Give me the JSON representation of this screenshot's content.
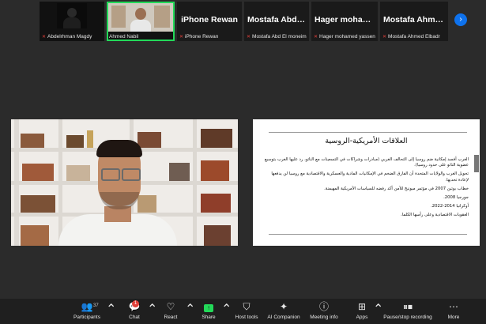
{
  "participants": [
    {
      "big": "",
      "caption": "Abdelrhman Magdy",
      "video": true
    },
    {
      "big": "",
      "caption": "Ahmed Nabil",
      "video": true,
      "active": true
    },
    {
      "big": "iPhone Rewan",
      "caption": "iPhone Rewan"
    },
    {
      "big": "Mostafa Abd El...",
      "caption": "Mostafa Abd El moneim"
    },
    {
      "big": "Hager mohame...",
      "caption": "Hager mohamed yassen"
    },
    {
      "big": "Mostafa Ahmed...",
      "caption": "Mostafa Ahmed Elbadr"
    }
  ],
  "slide": {
    "title": "العلاقات الأمريكية-الروسية",
    "bullets": [
      "الغرب أفسد إمكانية ضم روسيا إلى التحالف الغربي (مبادرات وشراكات في التسعينات مع الناتو، رد عليها الغرب بتوسيع عضوية الناتو على حدود روسيا).",
      "تحويل الغرب والولايات المتحدة أن الفارق الضخم في الإمكانيات المادية والعسكرية والاقتصادية مع روسيا لن يدفعها لإعادة تحديها.",
      "خطاب بوتين 2007 في مؤتمر ميونيخ للأمن أكد رفضه للسياسات الأمريكية المهيمنة.",
      "جورجيا 2008.",
      "أوكرانيا 2014-2022.",
      "العقوبات الاقتصادية وعلى رأسها الكلما."
    ]
  },
  "toolbar": {
    "participants_label": "Participants",
    "participants_count": "37",
    "chat_label": "Chat",
    "chat_badge": "1",
    "react_label": "React",
    "share_label": "Share",
    "host_tools_label": "Host tools",
    "ai_label": "AI Companion",
    "meeting_info_label": "Meeting info",
    "apps_label": "Apps",
    "recording_label": "Pause/stop recording",
    "more_label": "More"
  },
  "colors": {
    "active_border": "#23d959",
    "mic_muted": "#e0403a",
    "share": "#23d959",
    "accent": "#0e72ed"
  }
}
